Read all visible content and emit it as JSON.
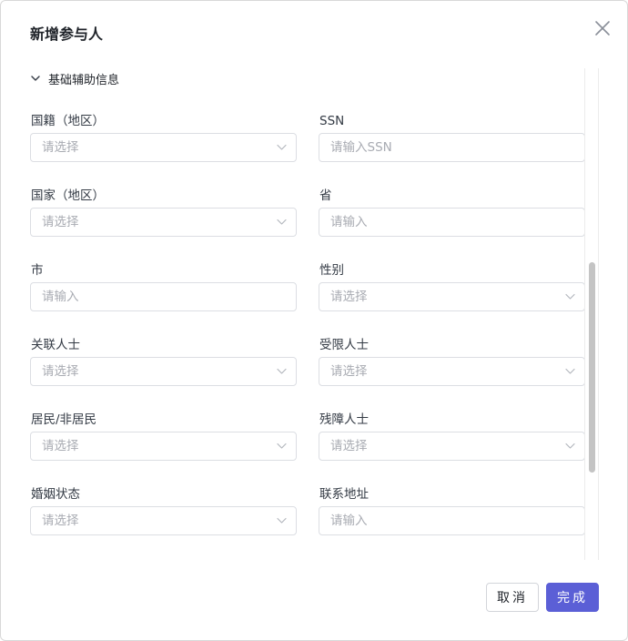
{
  "dialog": {
    "title": "新增参与人",
    "section_title": "基础辅助信息"
  },
  "fields": [
    {
      "label": "国籍（地区）",
      "placeholder": "请选择",
      "type": "select"
    },
    {
      "label": "SSN",
      "placeholder": "请输入SSN",
      "type": "input"
    },
    {
      "label": "国家（地区）",
      "placeholder": "请选择",
      "type": "select"
    },
    {
      "label": "省",
      "placeholder": "请输入",
      "type": "input"
    },
    {
      "label": "市",
      "placeholder": "请输入",
      "type": "input"
    },
    {
      "label": "性别",
      "placeholder": "请选择",
      "type": "select"
    },
    {
      "label": "关联人士",
      "placeholder": "请选择",
      "type": "select"
    },
    {
      "label": "受限人士",
      "placeholder": "请选择",
      "type": "select"
    },
    {
      "label": "居民/非居民",
      "placeholder": "请选择",
      "type": "select"
    },
    {
      "label": "残障人士",
      "placeholder": "请选择",
      "type": "select"
    },
    {
      "label": "婚姻状态",
      "placeholder": "请选择",
      "type": "select"
    },
    {
      "label": "联系地址",
      "placeholder": "请输入",
      "type": "input"
    }
  ],
  "footer": {
    "cancel_label": "取消",
    "done_label": "完成"
  },
  "colors": {
    "primary": "#5b5fd6",
    "border": "#dcdee3",
    "placeholder": "#a8abb2"
  },
  "icons": {
    "close": "close-icon",
    "section_toggle": "chevron-down-icon",
    "select_arrow": "chevron-down-icon"
  }
}
